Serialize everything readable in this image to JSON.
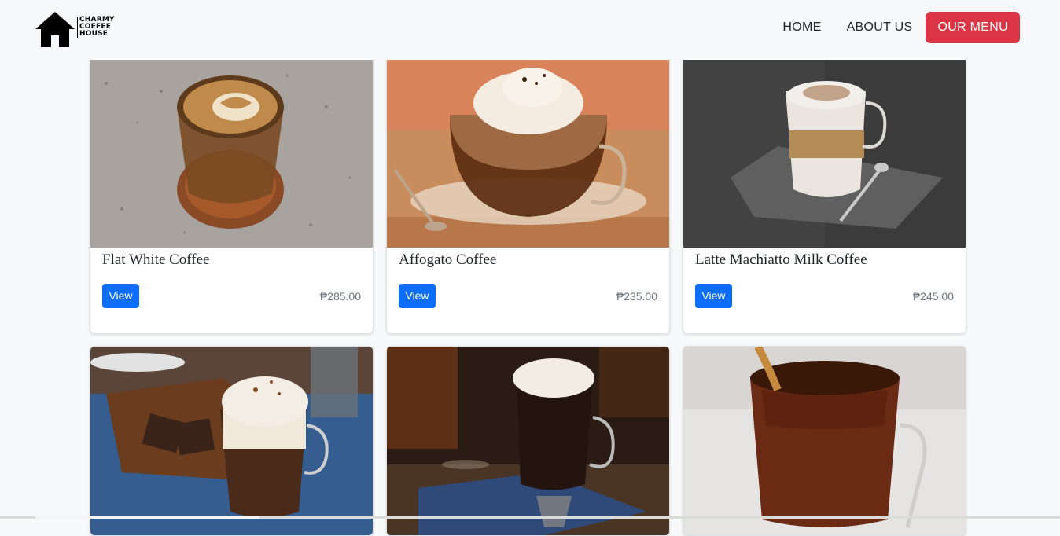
{
  "brand": {
    "line1": "CHARMY",
    "line2": "COFFEE",
    "line3": "HOUSE"
  },
  "nav": {
    "home": "HOME",
    "about": "ABOUT US",
    "menu": "OUR MENU"
  },
  "colors": {
    "accent": "#dc3545",
    "primary": "#0d6efd"
  },
  "products": [
    {
      "name": "Flat White Coffee",
      "button": "View",
      "price": "₱285.00"
    },
    {
      "name": "Affogato Coffee",
      "button": "View",
      "price": "₱235.00"
    },
    {
      "name": "Latte Machiatto Milk Coffee",
      "button": "View",
      "price": "₱245.00"
    }
  ]
}
